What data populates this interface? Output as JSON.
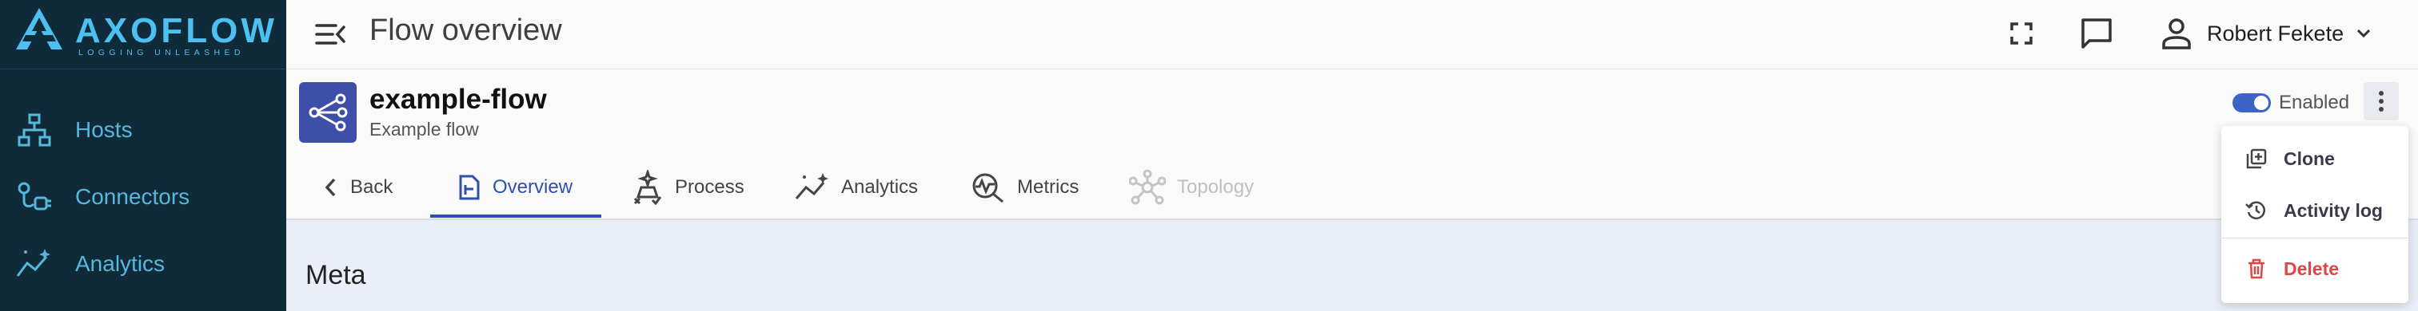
{
  "logo": {
    "name": "AXOFLOW",
    "tagline": "LOGGING UNLEASHED"
  },
  "sidebar": {
    "items": [
      {
        "label": "Hosts",
        "icon": "hosts-icon"
      },
      {
        "label": "Connectors",
        "icon": "connectors-icon"
      },
      {
        "label": "Analytics",
        "icon": "analytics-icon"
      }
    ]
  },
  "header": {
    "title": "Flow overview",
    "user_name": "Robert Fekete"
  },
  "flow": {
    "name": "example-flow",
    "description": "Example flow",
    "status_label": "Enabled",
    "enabled": true
  },
  "tabs": [
    {
      "label": "Back",
      "state": "normal"
    },
    {
      "label": "Overview",
      "state": "active"
    },
    {
      "label": "Process",
      "state": "normal"
    },
    {
      "label": "Analytics",
      "state": "normal"
    },
    {
      "label": "Metrics",
      "state": "normal"
    },
    {
      "label": "Topology",
      "state": "disabled"
    }
  ],
  "content": {
    "section_title": "Meta"
  },
  "menu": {
    "items": [
      {
        "label": "Clone",
        "icon": "clone-icon"
      },
      {
        "label": "Activity log",
        "icon": "history-icon"
      },
      {
        "label": "Delete",
        "icon": "trash-icon"
      }
    ]
  },
  "colors": {
    "sidebar_bg": "#0f2a38",
    "sidebar_accent": "#56b9dc",
    "primary": "#2f4fae",
    "flow_avatar": "#3e4fa7",
    "danger": "#e04646",
    "content_bg": "#e9eef8"
  }
}
